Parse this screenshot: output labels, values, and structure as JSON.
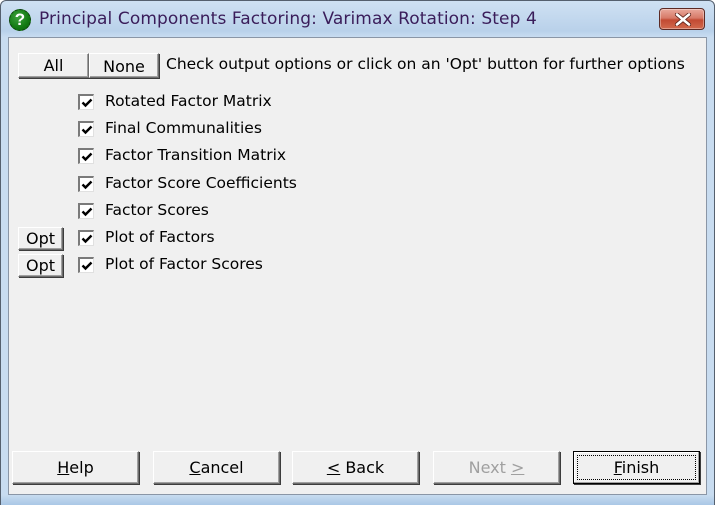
{
  "window": {
    "title": "Principal Components Factoring: Varimax Rotation: Step 4",
    "title_icon": "help-question-icon",
    "close_icon": "close-x-icon"
  },
  "toolbar": {
    "all_label": "All",
    "none_label": "None",
    "hint": "Check output options or click on an 'Opt' button for further options"
  },
  "options": [
    {
      "label": "Rotated Factor Matrix",
      "checked": true,
      "has_opt": false
    },
    {
      "label": "Final Communalities",
      "checked": true,
      "has_opt": false
    },
    {
      "label": "Factor Transition Matrix",
      "checked": true,
      "has_opt": false
    },
    {
      "label": "Factor Score Coefficients",
      "checked": true,
      "has_opt": false
    },
    {
      "label": "Factor Scores",
      "checked": true,
      "has_opt": false
    },
    {
      "label": "Plot of Factors",
      "checked": true,
      "has_opt": true,
      "opt_label": "Opt"
    },
    {
      "label": "Plot of Factor Scores",
      "checked": true,
      "has_opt": true,
      "opt_label": "Opt"
    }
  ],
  "footer": {
    "help": {
      "mnemonic": "H",
      "rest": "elp",
      "enabled": true
    },
    "cancel": {
      "mnemonic": "C",
      "rest": "ancel",
      "enabled": true
    },
    "back": {
      "prefix_mnemonic": "<",
      "rest": " Back",
      "enabled": true
    },
    "next": {
      "prefix": "Next ",
      "suffix_mnemonic": ">",
      "enabled": false
    },
    "finish": {
      "mnemonic": "F",
      "rest": "inish",
      "enabled": true,
      "default": true
    }
  }
}
